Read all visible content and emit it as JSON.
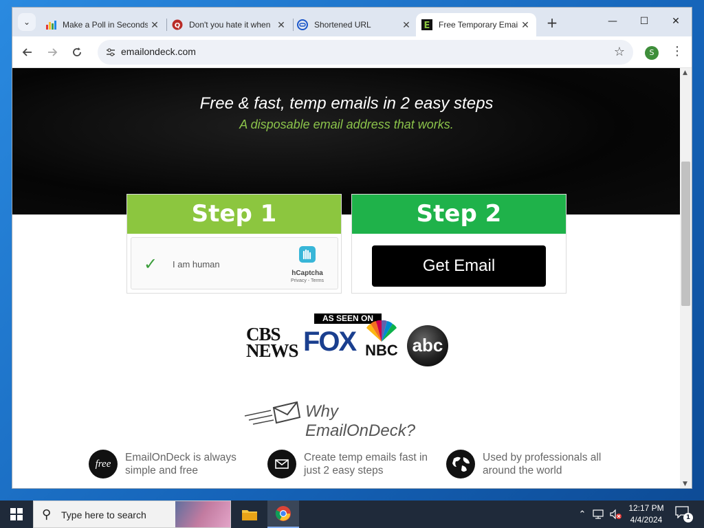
{
  "browser": {
    "tabs": [
      {
        "title": "Make a Poll in Seconds",
        "icon": "bar-chart-icon",
        "active": false
      },
      {
        "title": "Don't you hate it when",
        "icon": "q-icon",
        "active": false
      },
      {
        "title": "Shortened URL",
        "icon": "link-icon",
        "active": false
      },
      {
        "title": "Free Temporary Email",
        "icon": "e-logo-icon",
        "active": true
      }
    ],
    "new_tab": "+",
    "url": "emailondeck.com",
    "profile_initial": "S",
    "window_controls": {
      "minimize": "—",
      "maximize": "☐",
      "close": "✕"
    }
  },
  "hero": {
    "title": "Free & fast, temp emails in 2 easy steps",
    "subtitle": "A disposable email address that works."
  },
  "steps": {
    "step1_label": "Step 1",
    "step2_label": "Step 2",
    "step1_color": "#8cc63f",
    "step2_color": "#1fb24a",
    "captcha_label": "I am human",
    "captcha_brand": "hCaptcha",
    "captcha_links": "Privacy - Terms",
    "get_email_label": "Get Email"
  },
  "press": {
    "banner": "AS SEEN ON",
    "cbs": "CBS NEWS",
    "fox": "FOX",
    "nbc": "NBC",
    "abc": "abc"
  },
  "why": {
    "heading": "Why EmailOnDeck?"
  },
  "features": [
    {
      "icon": "free-badge-icon",
      "badge": "free",
      "text": "EmailOnDeck is always simple and free"
    },
    {
      "icon": "envelope-icon",
      "badge": "",
      "text": "Create temp emails fast in just 2 easy steps"
    },
    {
      "icon": "globe-icon",
      "badge": "",
      "text": "Used by professionals all around the world"
    }
  ],
  "taskbar": {
    "search_placeholder": "Type here to search",
    "time": "12:17 PM",
    "date": "4/4/2024",
    "notification_count": "1"
  }
}
